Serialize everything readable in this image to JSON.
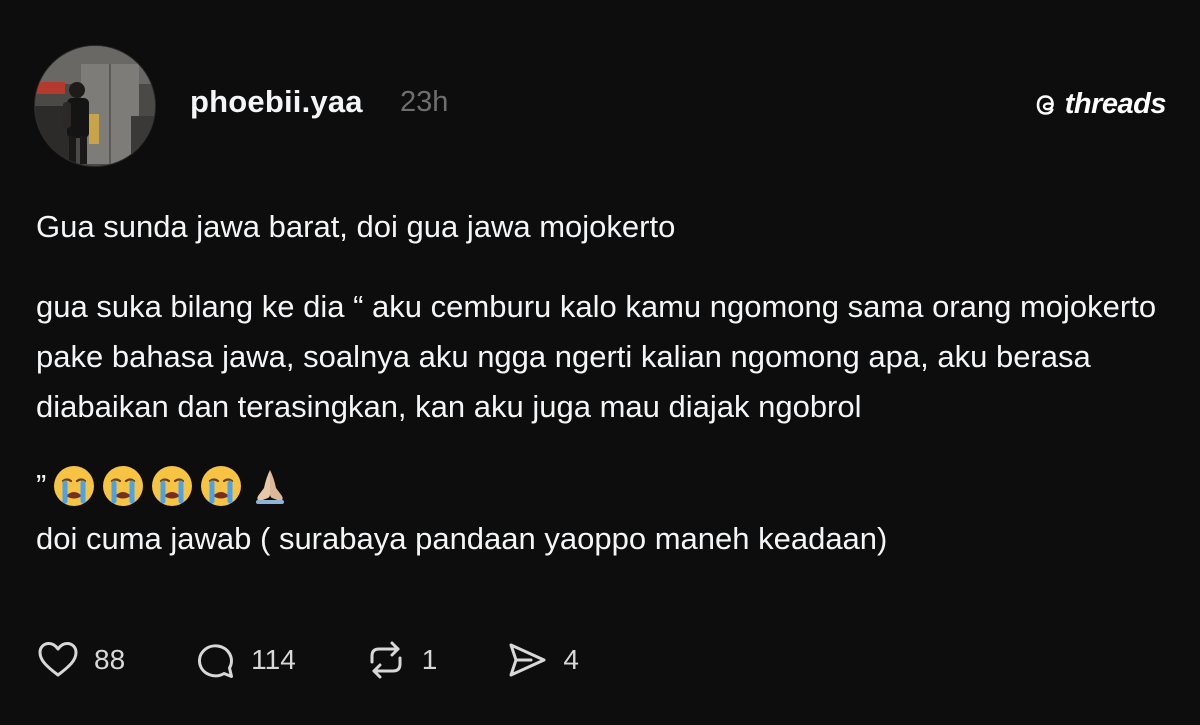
{
  "post": {
    "username": "phoebii.yaa",
    "time": "23h",
    "brand": "threads",
    "paragraph_1": "Gua sunda jawa barat, doi gua jawa mojokerto",
    "paragraph_2": "gua suka bilang ke dia “ aku cemburu kalo kamu ngomong sama orang mojokerto pake bahasa jawa, soalnya aku ngga ngerti kalian ngomong apa, aku berasa diabaikan dan terasingkan, kan aku juga mau diajak ngobrol",
    "closing_quote": "”",
    "emojis": [
      "crying-face",
      "crying-face",
      "crying-face",
      "crying-face",
      "folded-hands"
    ],
    "paragraph_3": "doi cuma jawab ( surabaya pandaan yaoppo maneh keadaan)"
  },
  "actions": {
    "likes": "88",
    "replies": "114",
    "reposts": "1",
    "shares": "4"
  },
  "colors": {
    "background": "#0d0d0d",
    "text": "#f3f5f7",
    "muted": "#6e6e6e"
  }
}
